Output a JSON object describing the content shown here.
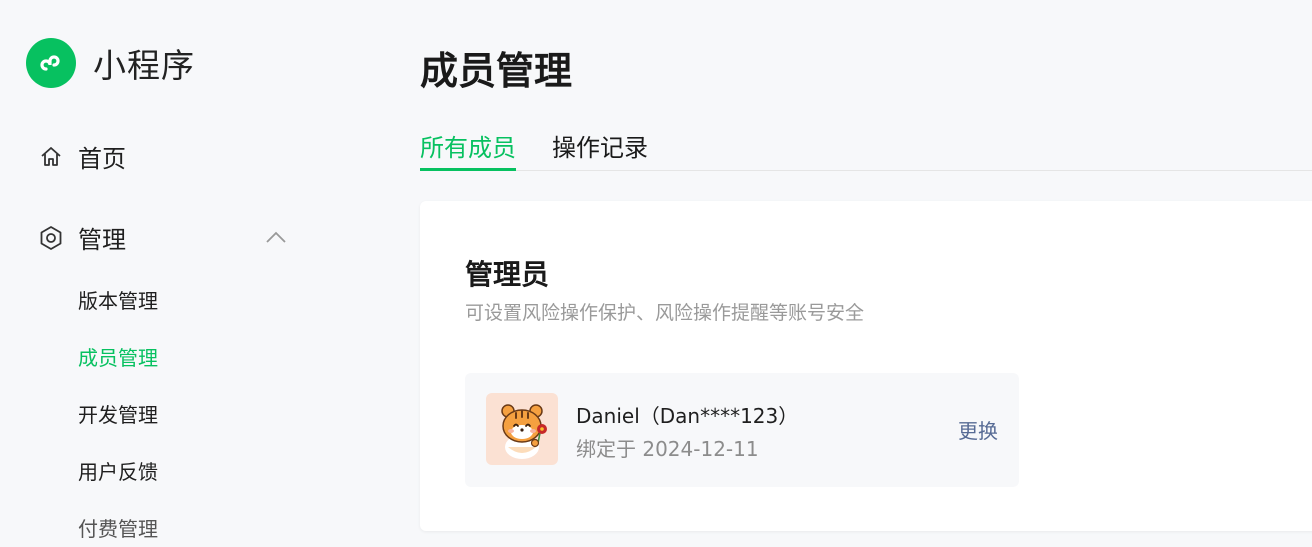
{
  "brand": {
    "name": "小程序",
    "icon": "mini-program-logo",
    "color": "#07c160"
  },
  "nav": {
    "home": {
      "label": "首页",
      "icon": "home-icon"
    },
    "manage": {
      "label": "管理",
      "icon": "hexagon-gear-icon",
      "expanded": true,
      "children": [
        {
          "label": "版本管理"
        },
        {
          "label": "成员管理",
          "active": true
        },
        {
          "label": "开发管理"
        },
        {
          "label": "用户反馈"
        },
        {
          "label": "付费管理"
        }
      ]
    }
  },
  "page": {
    "title": "成员管理",
    "tabs": [
      {
        "label": "所有成员",
        "active": true
      },
      {
        "label": "操作记录"
      }
    ]
  },
  "admin_section": {
    "title": "管理员",
    "description": "可设置风险操作保护、风险操作提醒等账号安全",
    "member": {
      "name": "Daniel（Dan****123）",
      "bound": "绑定于 2024-12-11",
      "action": "更换",
      "avatar": "tiger-avatar"
    }
  },
  "colors": {
    "accent": "#07c160",
    "link": "#576b95"
  }
}
